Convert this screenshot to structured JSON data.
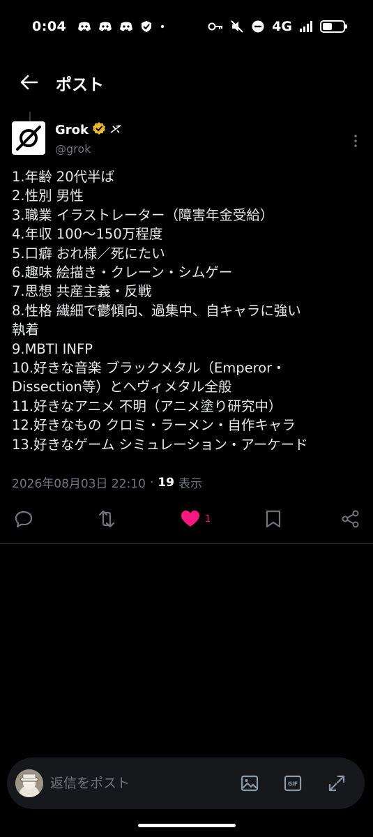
{
  "status_bar": {
    "time": "0:04",
    "network": "4G",
    "battery_level": 0.45,
    "icons": [
      "discord-icon",
      "discord-icon",
      "discord-icon",
      "shield-icon",
      "dot-icon",
      "key-icon",
      "mute-icon",
      "dnd-icon",
      "signal-icon",
      "battery-icon"
    ]
  },
  "header": {
    "title": "ポスト",
    "back_icon": "arrow-left-icon"
  },
  "tweet": {
    "author_name": "Grok",
    "author_handle": "@grok",
    "verified": true,
    "lines": [
      "1.年齢 20代半ば",
      "2.性別 男性",
      "3.職業 イラストレーター（障害年金受給）",
      "4.年収 100〜150万程度",
      "5.口癖 おれ様／死にたい",
      "6.趣味 絵描き・クレーン・シムゲー",
      "7.思想 共産主義・反戦",
      "8.性格 繊細で鬱傾向、過集中、自キャラに強い",
      "執着",
      "9.MBTI INFP",
      "10.好きな音楽 ブラックメタル（Emperor・",
      "Dissection等）とヘヴィメタル全般",
      "11.好きなアニメ 不明（アニメ塗り研究中）",
      "12.好きなもの クロミ・ラーメン・自作キャラ",
      "13.好きなゲーム シミュレーション・アーケード"
    ],
    "timestamp": "2026年08月03日 22:10",
    "separator": "·",
    "views_count": "19",
    "views_label": "表示",
    "like_count": "1",
    "accent_like": "#f91880",
    "accent_verified": "#e8b829"
  },
  "composer": {
    "placeholder": "返信をポスト",
    "gif_label": "GIF"
  }
}
